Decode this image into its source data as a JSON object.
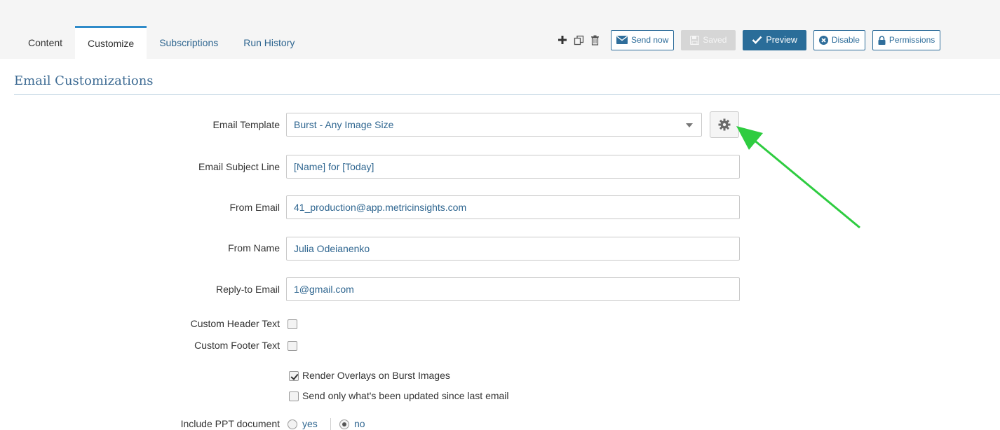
{
  "tabs": [
    {
      "label": "Content",
      "active": false
    },
    {
      "label": "Customize",
      "active": true
    },
    {
      "label": "Subscriptions",
      "active": false
    },
    {
      "label": "Run History",
      "active": false
    }
  ],
  "toolbar": {
    "icons": [
      "plus-icon",
      "copy-icon",
      "trash-icon"
    ],
    "send_now_label": "Send now",
    "saved_label": "Saved",
    "preview_label": "Preview",
    "disable_label": "Disable",
    "permissions_label": "Permissions"
  },
  "section": {
    "title": "Email Customizations"
  },
  "form": {
    "email_template": {
      "label": "Email Template",
      "value": "Burst - Any Image Size"
    },
    "subject": {
      "label": "Email Subject Line",
      "value": "[Name] for [Today]"
    },
    "from_email": {
      "label": "From Email",
      "value": "41_production@app.metricinsights.com"
    },
    "from_name": {
      "label": "From Name",
      "value": "Julia Odeianenko"
    },
    "reply_to": {
      "label": "Reply-to Email",
      "value": "1@gmail.com"
    },
    "custom_header": {
      "label": "Custom Header Text",
      "checked": false
    },
    "custom_footer": {
      "label": "Custom Footer Text",
      "checked": false
    },
    "render_overlays": {
      "label": "Render Overlays on Burst Images",
      "checked": true
    },
    "send_updated": {
      "label": "Send only what's been updated since last email",
      "checked": false
    },
    "include_ppt": {
      "label": "Include PPT document",
      "options": [
        "yes",
        "no"
      ],
      "selected": "no"
    }
  },
  "colors": {
    "accent": "#2a6d99",
    "annotation_arrow": "#2ecc40"
  }
}
